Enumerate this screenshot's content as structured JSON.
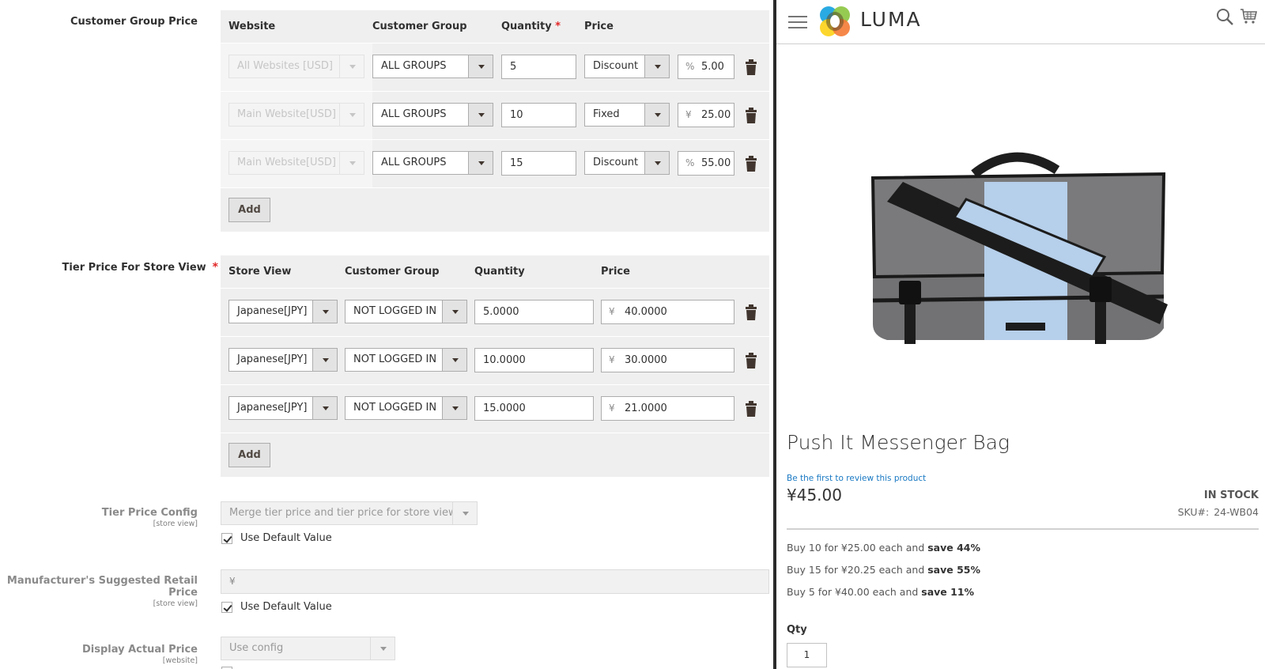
{
  "admin": {
    "customer_group_price": {
      "label": "Customer Group Price",
      "columns": [
        "Website",
        "Customer Group",
        "Quantity",
        "Price"
      ],
      "quantity_required_mark": "*",
      "rows": [
        {
          "website": "All Websites [USD]",
          "group": "ALL GROUPS",
          "qty": "5",
          "price_type": "Discount",
          "price_symbol": "%",
          "price_value": "5.00"
        },
        {
          "website": "Main Website[USD]",
          "group": "ALL GROUPS",
          "qty": "10",
          "price_type": "Fixed",
          "price_symbol": "¥",
          "price_value": "25.00"
        },
        {
          "website": "Main Website[USD]",
          "group": "ALL GROUPS",
          "qty": "15",
          "price_type": "Discount",
          "price_symbol": "%",
          "price_value": "55.00"
        }
      ],
      "add_label": "Add"
    },
    "tier_price_store_view": {
      "label": "Tier Price For Store View",
      "required_mark": "*",
      "columns": [
        "Store View",
        "Customer Group",
        "Quantity",
        "Price"
      ],
      "rows": [
        {
          "store_view": "Japanese[JPY]",
          "group": "NOT LOGGED IN",
          "qty": "5.0000",
          "price_symbol": "¥",
          "price_value": "40.0000"
        },
        {
          "store_view": "Japanese[JPY]",
          "group": "NOT LOGGED IN",
          "qty": "10.0000",
          "price_symbol": "¥",
          "price_value": "30.0000"
        },
        {
          "store_view": "Japanese[JPY]",
          "group": "NOT LOGGED IN",
          "qty": "15.0000",
          "price_symbol": "¥",
          "price_value": "21.0000"
        }
      ],
      "add_label": "Add"
    },
    "tier_price_config": {
      "label": "Tier Price Config",
      "scope": "[store view]",
      "value": "Merge tier price and tier price for store view",
      "use_default_label": "Use Default Value",
      "use_default_checked": true
    },
    "msrp": {
      "label": "Manufacturer's Suggested Retail Price",
      "scope": "[store view]",
      "currency_symbol": "¥",
      "value": "",
      "use_default_label": "Use Default Value",
      "use_default_checked": true
    },
    "display_actual_price": {
      "label": "Display Actual Price",
      "scope": "[website]",
      "value": "Use config"
    }
  },
  "store": {
    "logo_text": "LUMA",
    "product_name": "Push It Messenger Bag",
    "review_link": "Be the first to review this product",
    "price": "¥45.00",
    "stock": "IN STOCK",
    "sku_label": "SKU#:",
    "sku_value": "24-WB04",
    "tier_offers": [
      {
        "text": "Buy 10 for ¥25.00 each and ",
        "save": "save 44%"
      },
      {
        "text": "Buy 15 for ¥20.25 each and ",
        "save": "save 55%"
      },
      {
        "text": "Buy 5 for ¥40.00 each and ",
        "save": "save 11%"
      }
    ],
    "qty_label": "Qty",
    "qty_value": "1",
    "colors": {
      "link": "#1979c3",
      "required": "#e22626"
    }
  }
}
